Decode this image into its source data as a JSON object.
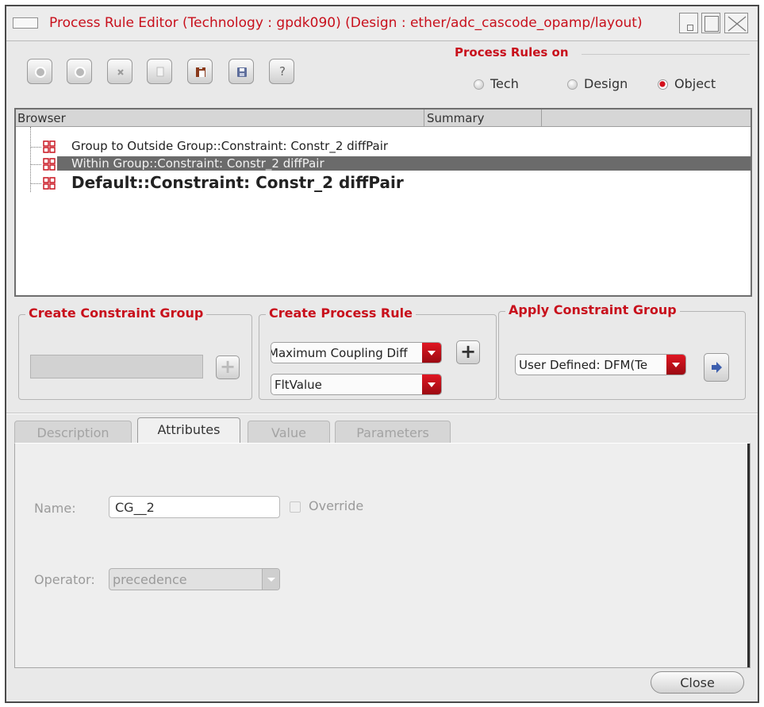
{
  "window": {
    "title": "Process Rule Editor (Technology : gpdk090) (Design : ether/adc_cascode_opamp/layout)"
  },
  "toolbar": {
    "icons": [
      "circle-icon",
      "circle-icon",
      "delete-icon",
      "copy-icon",
      "paste-icon",
      "save-icon",
      "help-icon"
    ],
    "help_label": "?"
  },
  "process_rules": {
    "label": "Process Rules on",
    "options": [
      {
        "label": "Tech",
        "selected": false
      },
      {
        "label": "Design",
        "selected": false
      },
      {
        "label": "Object",
        "selected": true
      }
    ]
  },
  "browser": {
    "columns": [
      "Browser",
      "Summary"
    ],
    "rows": [
      {
        "label": "Group to Outside Group::Constraint: Constr_2 diffPair",
        "selected": false
      },
      {
        "label": "Within Group::Constraint: Constr_2 diffPair",
        "selected": true
      },
      {
        "label": "Default::Constraint: Constr_2 diffPair",
        "selected": false
      }
    ]
  },
  "create_constraint_group": {
    "title": "Create Constraint Group",
    "value": "",
    "add_label": "+"
  },
  "create_process_rule": {
    "title": "Create Process Rule",
    "rule_value": "Maximum Coupling Diff",
    "type_value": "FltValue",
    "add_label": "+"
  },
  "apply_constraint_group": {
    "title": "Apply Constraint Group",
    "value": "User Defined: DFM(Te"
  },
  "tabs": [
    {
      "label": "Description",
      "active": false
    },
    {
      "label": "Attributes",
      "active": true
    },
    {
      "label": "Value",
      "active": false
    },
    {
      "label": "Parameters",
      "active": false
    }
  ],
  "attributes": {
    "name_label": "Name:",
    "name_value": "CG__2",
    "override_label": "Override",
    "operator_label": "Operator:",
    "operator_value": "precedence"
  },
  "footer": {
    "close_label": "Close"
  },
  "colors": {
    "accent_red": "#c8101c",
    "selection_gray": "#6b6b6b"
  }
}
